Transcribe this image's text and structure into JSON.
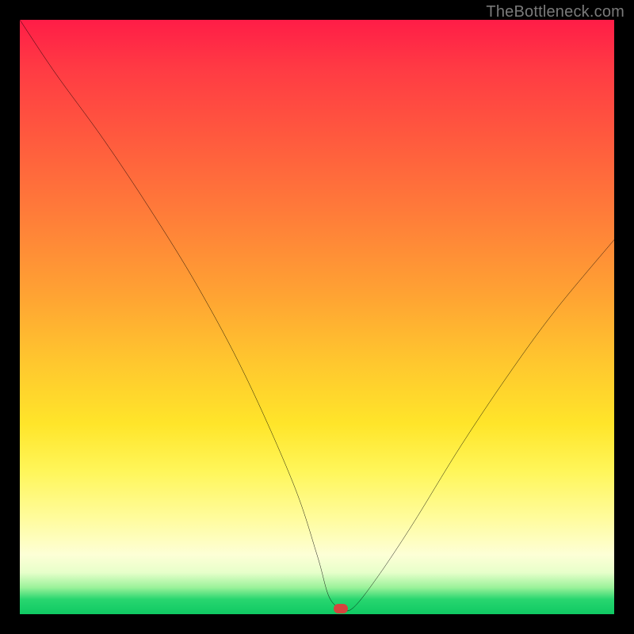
{
  "watermark": "TheBottleneck.com",
  "chart_data": {
    "type": "line",
    "title": "",
    "xlabel": "",
    "ylabel": "",
    "xlim": [
      0,
      100
    ],
    "ylim": [
      0,
      100
    ],
    "grid": false,
    "legend": false,
    "background": "heatmap-gradient (red top → orange → yellow → green bottom)",
    "series": [
      {
        "name": "bottleneck-curve",
        "color": "#000000",
        "x": [
          0,
          6,
          14,
          22,
          30,
          38,
          46,
          50,
          52,
          54,
          56,
          60,
          66,
          74,
          82,
          90,
          100
        ],
        "values": [
          100,
          91,
          80,
          68,
          55,
          40,
          22,
          10,
          3,
          1,
          1,
          6,
          15,
          28,
          40,
          51,
          63
        ]
      }
    ],
    "annotations": [
      {
        "name": "min-marker",
        "x": 54,
        "y": 1,
        "color": "#d6443e",
        "shape": "rounded-dot"
      }
    ]
  },
  "colors": {
    "frame": "#000000",
    "curve": "#000000",
    "marker": "#d6443e",
    "watermark": "#7a7a7a"
  }
}
